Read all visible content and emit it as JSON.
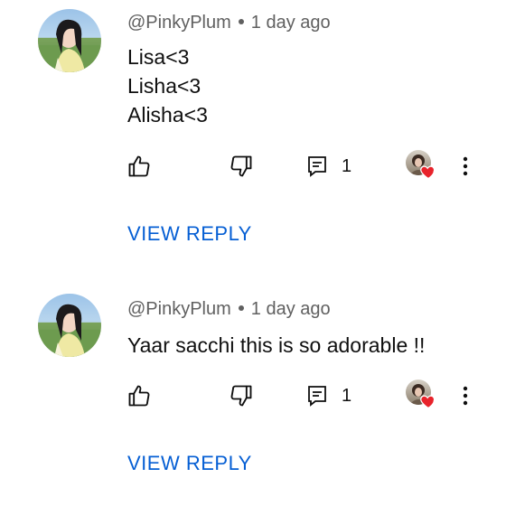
{
  "comments": [
    {
      "author": "@PinkyPlum",
      "time": "1 day ago",
      "lines": [
        "Lisa<3",
        "Lisha<3",
        "Alisha<3"
      ],
      "reply_count": "1",
      "view_reply_label": "VIEW REPLY"
    },
    {
      "author": "@PinkyPlum",
      "time": "1 day ago",
      "lines": [
        "Yaar sacchi this is so adorable !!"
      ],
      "reply_count": "1",
      "view_reply_label": "VIEW REPLY"
    }
  ],
  "icons": {
    "like": "thumb-up-icon",
    "dislike": "thumb-down-icon",
    "reply": "comment-reply-icon",
    "heart": "heart-icon",
    "more": "more-vert-icon"
  },
  "colors": {
    "link": "#065fd4",
    "heart": "#e8232b",
    "secondary_text": "#606060",
    "primary_text": "#0f0f0f"
  }
}
